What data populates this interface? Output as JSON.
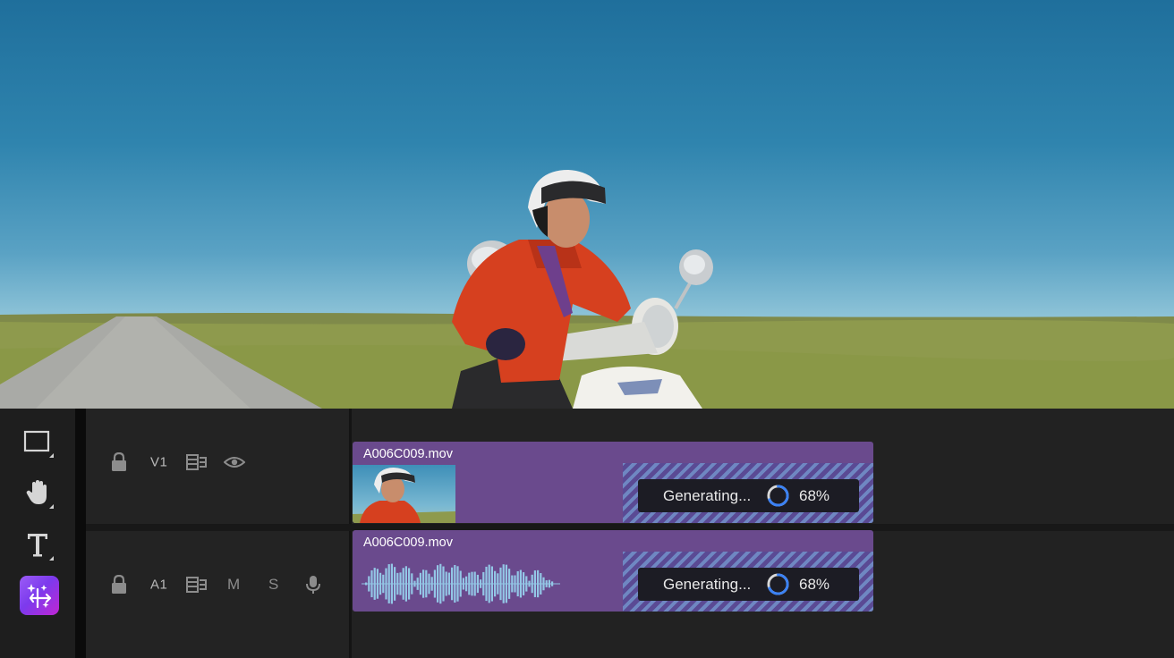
{
  "tools": [
    {
      "id": "rectangle",
      "icon": "rectangle-tool-icon"
    },
    {
      "id": "hand",
      "icon": "hand-tool-icon"
    },
    {
      "id": "type",
      "icon": "type-tool-icon"
    },
    {
      "id": "generative-extend",
      "icon": "generative-extend-icon",
      "active": true
    }
  ],
  "tracks": {
    "video": {
      "label": "V1",
      "controls": [
        "lock-icon",
        "sync-icon",
        "eye-icon"
      ],
      "clip": {
        "name": "A006C009.mov",
        "status": "Generating...",
        "progress": "68%",
        "progress_value": 0.68
      }
    },
    "audio": {
      "label": "A1",
      "controls": [
        "lock-icon",
        "sync-icon",
        "mute-icon",
        "solo-icon",
        "mic-icon"
      ],
      "mute_label": "M",
      "solo_label": "S",
      "clip": {
        "name": "A006C009.mov",
        "status": "Generating...",
        "progress": "68%",
        "progress_value": 0.68
      }
    }
  },
  "colors": {
    "clip": "#6a4a8d",
    "accent": "#3b82f6",
    "active_tool": "#8b5cf6"
  }
}
